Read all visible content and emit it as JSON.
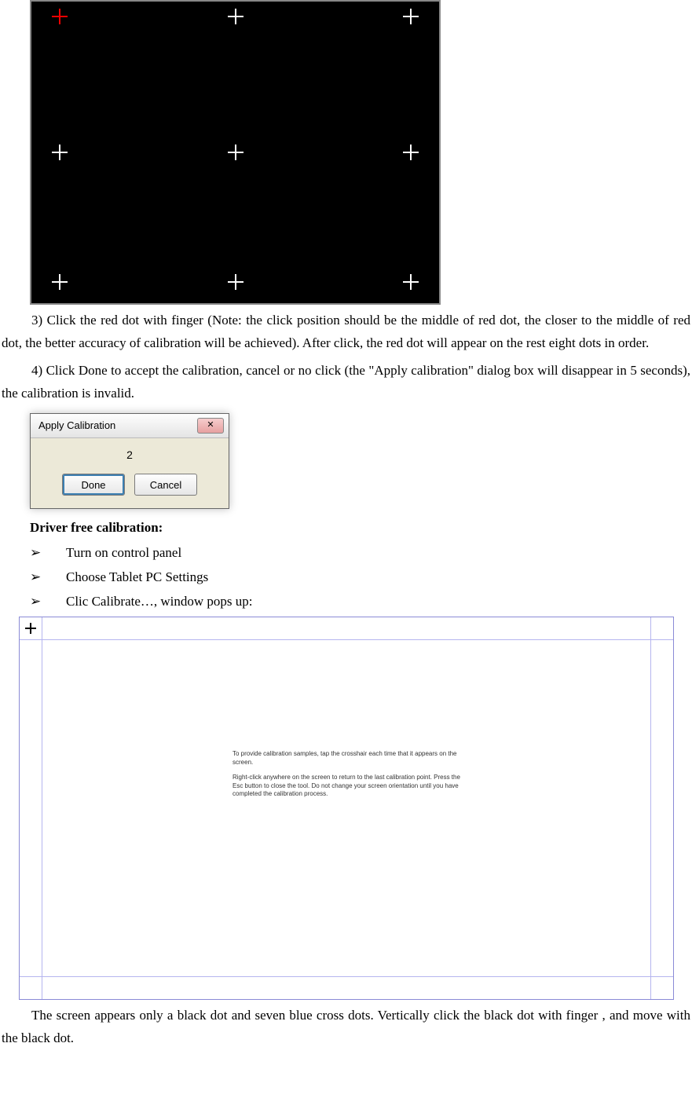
{
  "figure1": {
    "alt": "Black calibration screen with nine white crosshair dots in a 3×3 grid; the top-left crosshair is red."
  },
  "p1": "3) Click the red dot with finger (Note: the click position should be the middle of red dot, the closer to the middle of red dot, the better accuracy of calibration will be achieved). After click, the red dot will appear on the rest eight dots in order.",
  "p2": "4) Click Done to accept the calibration, cancel or no click (the \"Apply calibration\" dialog box will disappear in 5 seconds), the calibration is invalid.",
  "dialog": {
    "title": "Apply Calibration",
    "countdown": "2",
    "done": "Done",
    "cancel": "Cancel",
    "close_icon": "✕"
  },
  "subheading": "Driver free calibration:",
  "bullets": [
    "Turn on control panel",
    "Choose Tablet PC Settings",
    "Clic Calibrate…, window pops up:"
  ],
  "wincal": {
    "instr1": "To provide calibration samples, tap the crosshair each time that it appears on the screen.",
    "instr2": "Right-click anywhere on the screen to return to the last calibration point. Press the Esc button to close the tool. Do not change your screen orientation until you have completed the calibration process."
  },
  "p3": "The screen appears only a black dot and seven blue cross dots. Vertically click the black dot with finger , and move with the black dot."
}
